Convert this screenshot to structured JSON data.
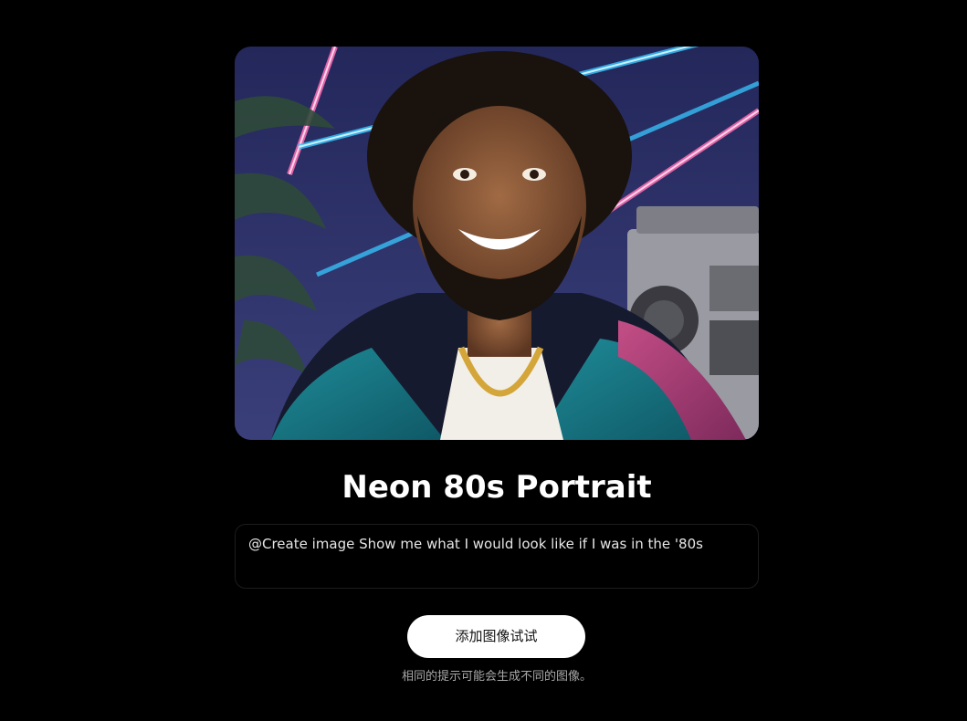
{
  "hero": {
    "image_subject": "neon-80s-portrait-photo"
  },
  "title": "Neon 80s Portrait",
  "prompt": {
    "text": "@Create image Show me what I would look like if I was in the '80s"
  },
  "actions": {
    "try_button_label": "添加图像试试"
  },
  "disclaimer": "相同的提示可能会生成不同的图像。",
  "colors": {
    "background": "#000000",
    "button_bg": "#ffffff",
    "button_text": "#111111",
    "title_text": "#ffffff",
    "disclaimer_text": "#a8a8a8"
  }
}
